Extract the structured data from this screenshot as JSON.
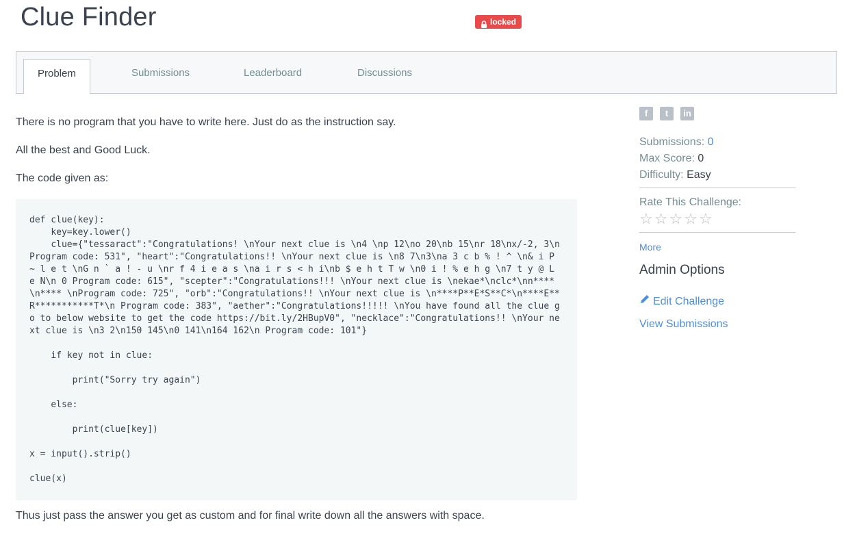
{
  "header": {
    "title": "Clue Finder",
    "badge_label": "locked"
  },
  "tabs": [
    {
      "label": "Problem",
      "active": true
    },
    {
      "label": "Submissions",
      "active": false
    },
    {
      "label": "Leaderboard",
      "active": false
    },
    {
      "label": "Discussions",
      "active": false
    }
  ],
  "problem": {
    "para1": "There is no program that you have to write here. Just do as the instruction say.",
    "para2": "All the best and Good Luck.",
    "para3": "The code given as:",
    "code_block1": "def clue(key):\n    key=key.lower()\n    clue={\"tessaract\":\"Congratulations! \\nYour next clue is \\n4 \\np 12\\no 20\\nb 15\\nr 18\\nx/-2, 3\\nProgram code: 531\", \"heart\":\"Congratulations!! \\nYour next clue is \\n8 7\\n3\\na 3 c b % ! ^ \\n& i P ~ l e t \\nG n ` a ! - u \\nr f 4 i e a s \\na i r s < h i\\nb $ e h t T w \\n0 i ! % e h g \\n7 t y @ L e N\\n 0 Program code: 615\", \"scepter\":\"Congratulations!!! \\nYour next clue is \\nekae*\\nclc*\\nn****\\n**** \\nProgram code: 725\", \"orb\":\"Congratulations!! \\nYour next clue is \\n****P**E*S**C*\\n****E**R***********T*\\n Program code: 383\", \"aether\":\"Congratulations!!!!! \\nYou have found all the clue go to below website to get the code https://bit.ly/2HBupV0\", \"necklace\":\"Congratulations!! \\nYour next clue is \\n3 2\\n150 145\\n0 141\\n164 162\\n Program code: 101\"}",
    "code_if": "    if key not in clue:",
    "code_print1": "        print(\"Sorry try again\")",
    "code_else": "    else:",
    "code_print2": "        print(clue[key])",
    "code_x": "x = input().strip()",
    "code_call": "clue(x)",
    "footer": "Thus just pass the answer you get as custom and for final write down all the answers with space."
  },
  "sidebar": {
    "social_icons": [
      "facebook-icon",
      "twitter-icon",
      "linkedin-icon"
    ],
    "submissions_label": "Submissions:",
    "submissions_value": "0",
    "max_score_label": "Max Score:",
    "max_score_value": "0",
    "difficulty_label": "Difficulty:",
    "difficulty_value": "Easy",
    "rate_label": "Rate This Challenge:",
    "more_label": "More",
    "admin_title": "Admin Options",
    "edit_label": "Edit Challenge",
    "view_label": "View Submissions"
  },
  "colors": {
    "accent": "#4d8fd9",
    "badge": "#e84a4a",
    "text": "#39424e",
    "muted": "#738f93",
    "code_bg": "#f3f7f7"
  }
}
